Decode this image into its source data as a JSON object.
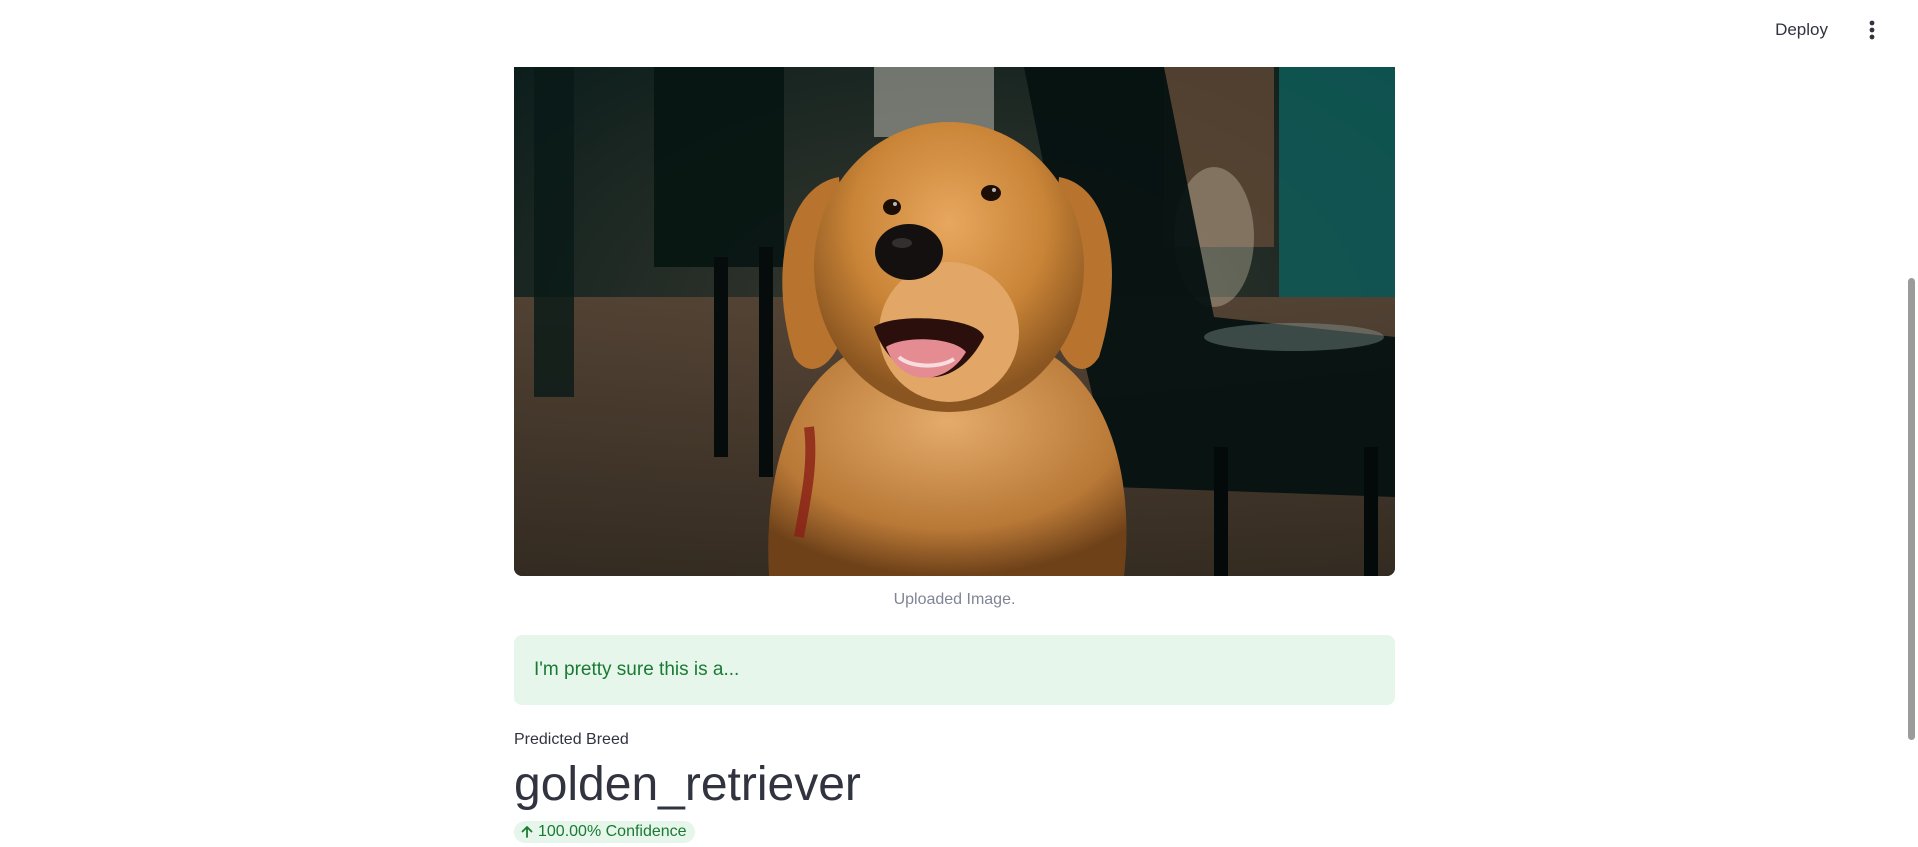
{
  "header": {
    "deploy_label": "Deploy",
    "menu_icon": "kebab-menu-icon"
  },
  "image": {
    "caption": "Uploaded Image.",
    "subject": "golden retriever dog photo"
  },
  "status": {
    "message": "I'm pretty sure this is a..."
  },
  "metric": {
    "label": "Predicted Breed",
    "value": "golden_retriever",
    "delta": "100.00% Confidence",
    "delta_icon": "arrow-up-icon",
    "delta_color": "#1a7a34"
  },
  "colors": {
    "success_bg": "#e6f6ea",
    "text": "#31333f",
    "caption": "#808495"
  }
}
